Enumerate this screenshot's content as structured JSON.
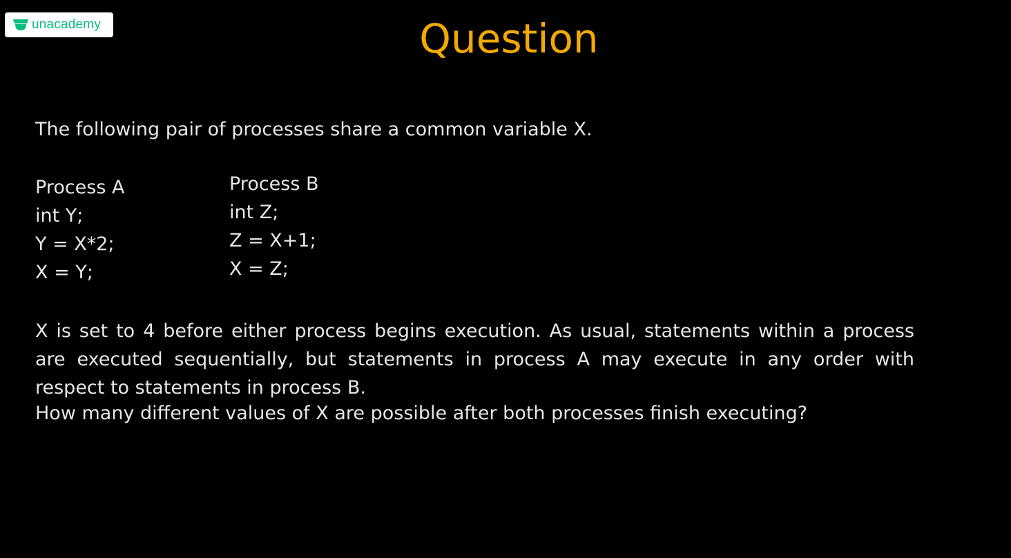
{
  "brand": {
    "name": "unacademy",
    "color": "#08bd80"
  },
  "slide": {
    "title": "Question",
    "title_color": "#f2a900",
    "intro": "The following pair of processes share a common variable X.",
    "process_a": {
      "heading": "Process A",
      "lines": [
        "int Y;",
        "Y = X*2;",
        "X = Y;"
      ]
    },
    "process_b": {
      "heading": "Process B",
      "lines": [
        "int Z;",
        "Z = X+1;",
        "X = Z;"
      ]
    },
    "paragraph": "X is set to 4 before either process begins execution. As usual, statements within a process are executed sequentially, but statements in process A may execute in any order with respect to statements in process B.",
    "question": "How many different values of X are possible after both processes finish executing?"
  }
}
